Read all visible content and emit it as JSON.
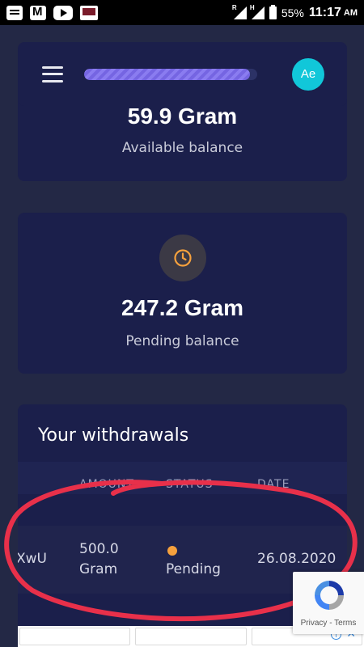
{
  "status_bar": {
    "signal_r": "R",
    "signal_h": "H",
    "battery_percent": "55%",
    "time": "11:17",
    "ampm": "AM",
    "icons": [
      "message-icon",
      "gmail-icon",
      "youtube-icon",
      "book-app-icon"
    ]
  },
  "header": {
    "avatar_initials": "Ae",
    "progress_fraction": 0.96
  },
  "available": {
    "amount": "59.9 Gram",
    "label": "Available balance"
  },
  "pending": {
    "amount": "247.2 Gram",
    "label": "Pending balance",
    "icon": "clock-icon"
  },
  "withdrawals": {
    "title": "Your withdrawals",
    "columns": [
      "AMOUNT",
      "STATUS",
      "DATE"
    ],
    "rows": [
      {
        "id": "XwU",
        "amount_value": "500.0",
        "amount_unit": "Gram",
        "status": "Pending",
        "date": "26.08.2020"
      }
    ]
  },
  "recaptcha": {
    "text": "Privacy - Terms"
  },
  "colors": {
    "background": "#232845",
    "card": "#1b1f4b",
    "accent": "#11c7d9",
    "pending": "#f6a13d",
    "progress": "#8a7cf0",
    "scribble": "#e8304a"
  }
}
